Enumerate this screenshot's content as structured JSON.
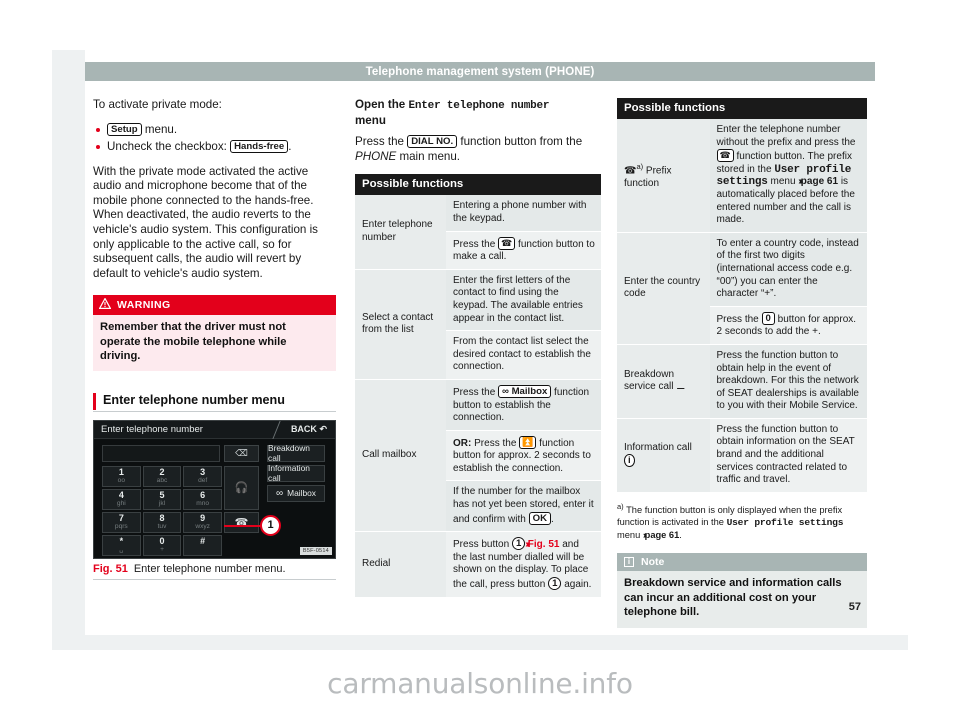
{
  "header": {
    "title": "Telephone management system (PHONE)"
  },
  "page_number": "57",
  "watermark": "carmanualsonline.info",
  "left_column": {
    "intro": "To activate private mode:",
    "bullets": [
      {
        "prefix": "",
        "chip": "Setup",
        "suffix": " menu."
      },
      {
        "prefix": "Uncheck the checkbox: ",
        "chip": "Hands-free",
        "suffix": "."
      }
    ],
    "paragraph": "With the private mode activated the active audio and microphone become that of the mobile phone connected to the hands-free. When deactivated, the audio reverts to the vehicle's audio system. This configuration is only applicable to the active call, so for subsequent calls, the audio will revert by default to vehicle's audio system.",
    "warning": {
      "icon": "warning-triangle-icon",
      "title": "WARNING",
      "body": "Remember that the driver must not operate the mobile telephone while driving."
    },
    "section_heading": "Enter telephone number menu",
    "figure": {
      "screen": {
        "title": "Enter telephone number",
        "back_label": "BACK",
        "back_icon": "return-arrow-icon",
        "delete_icon": "backspace-icon",
        "keys": [
          {
            "num": "1",
            "sub": "oo"
          },
          {
            "num": "2",
            "sub": "abc"
          },
          {
            "num": "3",
            "sub": "def"
          },
          {
            "num": "4",
            "sub": "ghi"
          },
          {
            "num": "5",
            "sub": "jkl"
          },
          {
            "num": "6",
            "sub": "mno"
          },
          {
            "num": "7",
            "sub": "pqrs"
          },
          {
            "num": "8",
            "sub": "tuv"
          },
          {
            "num": "9",
            "sub": "wxyz"
          },
          {
            "num": "*",
            "sub": "␣"
          },
          {
            "num": "0",
            "sub": "+"
          },
          {
            "num": "#",
            "sub": ""
          }
        ],
        "side_keys": [
          {
            "icon": "headset-icon",
            "glyph": "☎"
          },
          {
            "icon": "call-handset-icon",
            "glyph": "✆"
          },
          {
            "icon": "prefix-call-icon",
            "glyph": "✆"
          }
        ],
        "right_buttons": [
          {
            "label": "Breakdown call",
            "icon": ""
          },
          {
            "label": "Information call",
            "icon": ""
          },
          {
            "label": "Mailbox",
            "icon": "mailbox-icon"
          }
        ],
        "callout_number": "1",
        "image_code": "B5F-0514"
      },
      "caption_ref": "Fig. 51",
      "caption_text": "Enter telephone number menu."
    }
  },
  "middle_column": {
    "heading_prefix": "Open the ",
    "heading_mono": "Enter telephone number",
    "heading_suffix": "menu",
    "instruction": {
      "before": "Press the ",
      "chip": "DIAL NO.",
      "after_1": " function button from the ",
      "italic": "PHONE",
      "after_2": " main menu."
    },
    "table": {
      "header": "Possible functions",
      "rows": [
        {
          "label": "Enter telephone number",
          "cells": [
            {
              "text": "Entering a phone number with the keypad."
            },
            {
              "text_before": "Press the ",
              "icon": "call-handset-icon",
              "text_after": " function button to make a call."
            }
          ]
        },
        {
          "label": "Select a contact from the list",
          "cells": [
            {
              "text": "Enter the first letters of the contact to find using the keypad. The available entries appear in the contact list."
            },
            {
              "text": "From the contact list select the desired contact to establish the connection."
            }
          ]
        },
        {
          "label": "Call mailbox",
          "cells": [
            {
              "text_before": "Press the ",
              "chip": "Mailbox",
              "text_after": " function button to establish the connection."
            },
            {
              "bold_prefix": "OR:",
              "text_before": " Press the ",
              "icon": "mailbox-key-icon",
              "text_after": " function button for approx. 2 seconds to establish the connection."
            },
            {
              "text_before": "If the number for the mailbox has not yet been stored, enter it and confirm with ",
              "chip": "OK",
              "text_after": "."
            }
          ]
        },
        {
          "label": "Redial",
          "cells": [
            {
              "text_before": "Press button ",
              "callout": "1",
              "ref": "Fig. 51",
              "text_after": " and the last number dialled will be shown on the display. To place the call, press button ",
              "callout2": "1",
              "text_end": " again."
            }
          ]
        }
      ]
    }
  },
  "right_column": {
    "table": {
      "header": "Possible functions",
      "rows": [
        {
          "label": "Prefix function",
          "label_icon": "prefix-call-icon",
          "label_footnote": "a)",
          "cells": [
            {
              "t1": "Enter the telephone number without the prefix and press the ",
              "icon": "call-handset-icon",
              "t2": " function button. The prefix stored in the ",
              "mono": "User profile settings",
              "t3": " menu ",
              "arrows": "›››",
              "ref": "page 61",
              "t4": " is automatically placed before the entered number and the call is made."
            }
          ]
        },
        {
          "label": "Enter the country code",
          "cells": [
            {
              "text": "To enter a country code, instead of the first two digits (international access code e.g. “00”) you can enter the character “+”."
            },
            {
              "text_before": "Press the ",
              "chip": "0",
              "text_after": " button for approx. 2 seconds to add the +."
            }
          ]
        },
        {
          "label": "Breakdown service call",
          "label_icon": "wrench-icon",
          "cells": [
            {
              "text": "Press the function button to obtain help in the event of breakdown. For this the network of SEAT dealerships is available to you with their Mobile Service."
            }
          ]
        },
        {
          "label": "Information call",
          "label_icon": "info-circle-icon",
          "cells": [
            {
              "text": "Press the function button to obtain information on the SEAT brand and the additional services contracted related to traffic and travel."
            }
          ]
        }
      ]
    },
    "footnote": {
      "mark": "a)",
      "t1": "The function button is only displayed when the prefix function is activated in the ",
      "mono": "User profile settings",
      "t2": " menu ",
      "arrows": "›››",
      "ref": "page 61",
      "t3": "."
    },
    "note": {
      "icon": "info-icon",
      "title": "Note",
      "body": "Breakdown service and information calls can incur an additional cost on your telephone bill."
    }
  }
}
